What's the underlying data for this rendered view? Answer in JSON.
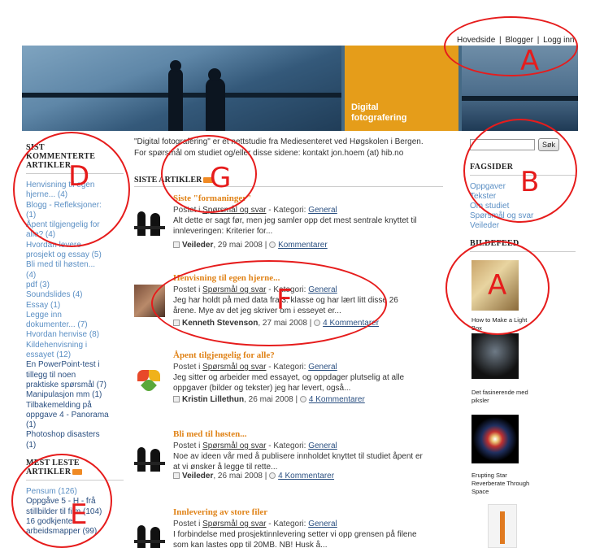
{
  "topnav": {
    "hovedside": "Hovedside",
    "sep": "|",
    "blogger": "Blogger",
    "logg_inn": "Logg inn"
  },
  "banner": {
    "title_line1": "Digital",
    "title_line2": "fotografering"
  },
  "intro": {
    "line1": "\"Digital fotografering\" er et nettstudie fra Mediesenteret ved Høgskolen i Bergen.",
    "line2": "For spørsmål om studiet og/eller disse sidene: kontakt jon.hoem (at) hib.no"
  },
  "siste": {
    "heading": "SISTE ARTIKLER"
  },
  "left": {
    "heading1_l1": "SIST",
    "heading1_l2": "KOMMENTERTE",
    "heading1_l3": "ARTIKLER",
    "items1": [
      {
        "t": "Henvisning til egen"
      },
      {
        "t": "hjerne... (4)"
      },
      {
        "t": "Blogg - Refleksjoner:"
      },
      {
        "t": "(1)"
      },
      {
        "t": "Åpent tilgjengelig for"
      },
      {
        "t": "alle? (4)"
      },
      {
        "t": "Hvordan levere"
      },
      {
        "t": "prosjekt og essay (5)"
      },
      {
        "t": "Bli med til høsten..."
      },
      {
        "t": "(4)"
      },
      {
        "t": "pdf (3)"
      },
      {
        "t": "Soundslides (4)"
      },
      {
        "t": "Essay (1)"
      },
      {
        "t": "Legge inn"
      },
      {
        "t": "dokumenter... (7)"
      },
      {
        "t": "Hvordan henvise (8)"
      },
      {
        "t": "Kildehenvisning i"
      },
      {
        "t": "essayet (12)"
      },
      {
        "t": "En PowerPoint-test i",
        "d": true
      },
      {
        "t": "tillegg til noen",
        "d": true
      },
      {
        "t": "praktiske spørsmål (7)",
        "d": true
      },
      {
        "t": "Manipulasjon mm (1)",
        "d": true
      },
      {
        "t": "Tilbakemelding på",
        "d": true
      },
      {
        "t": "oppgave 4 - Panorama",
        "d": true
      },
      {
        "t": "(1)",
        "d": true
      },
      {
        "t": "Photoshop disasters",
        "d": true
      },
      {
        "t": "(1)",
        "d": true
      }
    ],
    "heading2_l1": "MEST LESTE",
    "heading2_l2": "ARTIKLER",
    "items2": [
      {
        "t": "Pensum (126)"
      },
      {
        "t": "Oppgåve 5 - H - frå",
        "d": true
      },
      {
        "t": "stillbilder til film (104)",
        "d": true
      },
      {
        "t": "16 godkjente",
        "d": true
      },
      {
        "t": "arbeidsmapper (99)",
        "d": true
      }
    ]
  },
  "posts": [
    {
      "title": "Siste \"formaninger\"",
      "postet": "Postet i",
      "cat_link": "Spørsmål og svar",
      "kategori": " - Kategori:",
      "kat": "General",
      "body1": "Alt dette er sagt før, men jeg samler opp det mest sentrale knyttet til",
      "body2": "innleveringen:   Kriterier for...",
      "author": "Veileder",
      "date": ", 29 mai 2008 |",
      "comments": "Kommentarer"
    },
    {
      "title": "Henvisning til egen hjerne...",
      "postet": "Postet i",
      "cat_link": "Spørsmål og svar",
      "kategori": " - Kategori:",
      "kat": "General",
      "body1": "Jeg har holdt på med data fra 3. klasse og har lært litt disse 26",
      "body2": "årene. Mye av det jeg skriver om i esseyet er...",
      "author": "Kenneth Stevenson",
      "date": ", 27 mai 2008 |",
      "comments": "4 Kommentarer"
    },
    {
      "title": "Åpent tilgjengelig for alle?",
      "postet": "Postet i",
      "cat_link": "Spørsmål og svar",
      "kategori": " - Kategori:",
      "kat": "General",
      "body1": "Jeg sitter og arbeider med essayet, og oppdager plutselig at alle",
      "body2": "oppgaver (bilder og tekster) jeg har levert, også...",
      "author": "Kristin Lillethun",
      "date": ", 26 mai 2008 |",
      "comments": "4 Kommentarer"
    },
    {
      "title": "Bli med til høsten...",
      "postet": "Postet i",
      "cat_link": "Spørsmål og svar",
      "kategori": " - Kategori:",
      "kat": "General",
      "body1": "Noe av ideen vår med å publisere innholdet knyttet til studiet åpent er",
      "body2": "at vi ønsker å legge til rette...",
      "author": "Veileder",
      "date": ", 26 mai 2008 |",
      "comments": "4 Kommentarer"
    },
    {
      "title": "Innlevering av store filer",
      "postet": "Postet i",
      "cat_link": "Spørsmål og svar",
      "kategori": " - Kategori:",
      "kat": "General",
      "body1": "I forbindelse med prosjektinnlevering setter vi opp grensen på filene",
      "body2": "som kan lastes opp til 20MB. NB! Husk å...",
      "author": "",
      "date": "",
      "comments": ""
    }
  ],
  "right": {
    "search_btn": "Søk",
    "fagsider_heading": "FAGSIDER",
    "fagsider": [
      {
        "t": "Oppgaver"
      },
      {
        "t": "Tekster"
      },
      {
        "t": "Om studiet"
      },
      {
        "t": "Spørsmål og svar"
      },
      {
        "t": "Veileder"
      }
    ],
    "bildefeed_heading": "BILDEFEED",
    "captions": {
      "c1": "How to Make a Light Box",
      "c2a": "Det fasinerende med",
      "c2b": "piksler",
      "c3a": "Erupting Star",
      "c3b": "Reverberate Through",
      "c3c": "Space"
    }
  },
  "annotations": {
    "A": "A",
    "B": "B",
    "D": "D",
    "G": "G",
    "F": "F",
    "C": "A",
    "E": "E"
  },
  "colors": {
    "orange": "#e59d1a",
    "link": "#5b8fc4",
    "dark_link": "#2a4f80",
    "red": "#e61c1c"
  }
}
